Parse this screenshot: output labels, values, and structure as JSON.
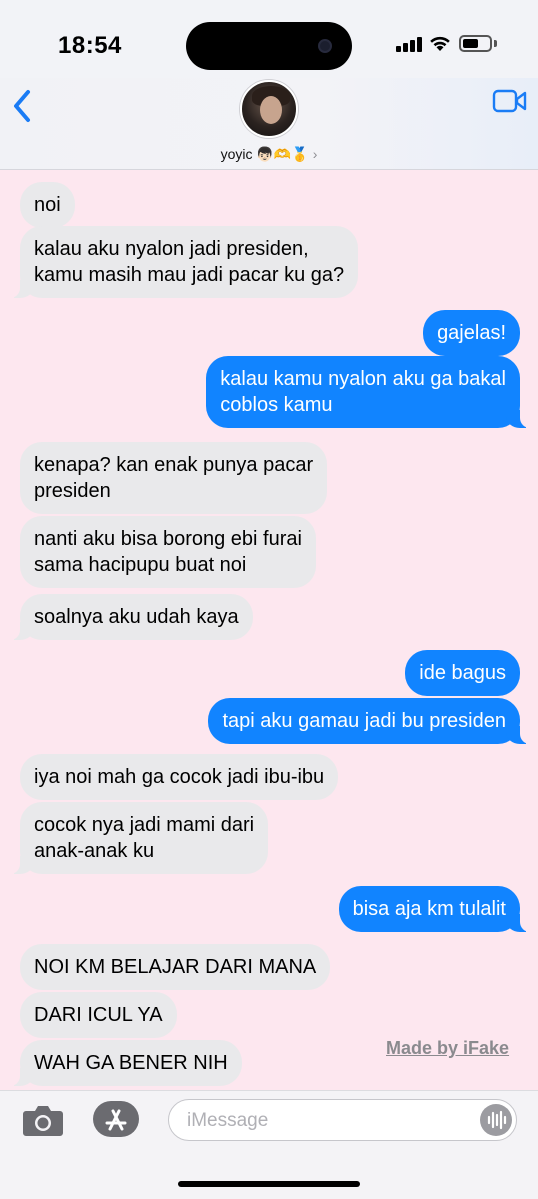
{
  "status": {
    "time": "18:54"
  },
  "header": {
    "contact_name": "yoyic 👦🏻🫶🥇",
    "chevron": "›",
    "icons": [
      "back-chevron-icon",
      "video-call-icon"
    ]
  },
  "messages": [
    {
      "side": "in",
      "text": "noi"
    },
    {
      "side": "in",
      "text": "kalau aku nyalon jadi presiden,\nkamu masih mau jadi pacar ku ga?"
    },
    {
      "side": "out",
      "text": "gajelas!"
    },
    {
      "side": "out",
      "text": "kalau kamu nyalon aku ga bakal\ncoblos kamu"
    },
    {
      "side": "in",
      "text": "kenapa? kan enak punya pacar\npresiden"
    },
    {
      "side": "in",
      "text": "nanti aku bisa borong ebi furai\nsama hacipupu buat noi"
    },
    {
      "side": "in",
      "text": "soalnya aku udah kaya"
    },
    {
      "side": "out",
      "text": "ide bagus"
    },
    {
      "side": "out",
      "text": "tapi aku gamau jadi bu presiden"
    },
    {
      "side": "in",
      "text": "iya noi mah ga cocok jadi ibu-ibu"
    },
    {
      "side": "in",
      "text": "cocok nya jadi mami dari\nanak-anak ku"
    },
    {
      "side": "out",
      "text": "bisa aja km tulalit"
    },
    {
      "side": "in",
      "text": "NOI KM BELAJAR DARI MANA"
    },
    {
      "side": "in",
      "text": "DARI ICUL YA"
    },
    {
      "side": "in",
      "text": "WAH GA BENER NIH"
    }
  ],
  "watermark": "Made by iFake",
  "composer": {
    "placeholder": "iMessage"
  },
  "colors": {
    "outgoing": "#1184ff",
    "incoming": "#e9e9eb",
    "background": "#fde7ef"
  }
}
